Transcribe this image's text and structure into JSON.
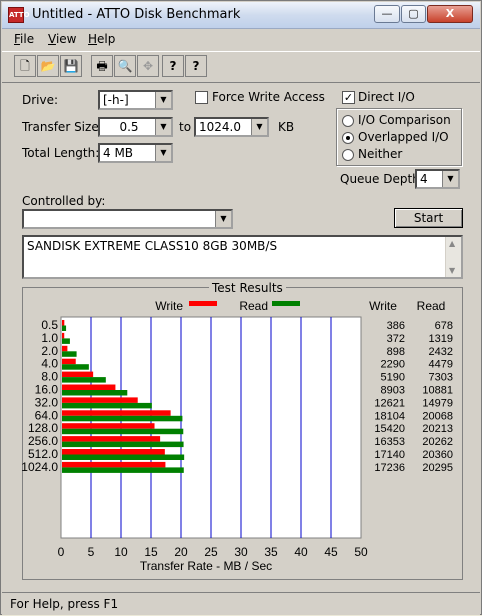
{
  "window": {
    "title": "Untitled - ATTO Disk Benchmark",
    "app_icon_text": "ATTO",
    "minimize_label": "—",
    "maximize_label": "▢",
    "close_label": "X"
  },
  "menu": {
    "items": [
      {
        "mnemonic": "F",
        "rest": "ile"
      },
      {
        "mnemonic": "V",
        "rest": "iew"
      },
      {
        "mnemonic": "H",
        "rest": "elp"
      }
    ]
  },
  "toolbar": {
    "icons": [
      "new-file-icon",
      "open-folder-icon",
      "save-icon",
      "print-icon",
      "print-preview-icon",
      "move-icon",
      "help-icon",
      "context-help-icon"
    ],
    "glyphs": [
      "🗋",
      "📂",
      "💾",
      "🖶",
      "🔍",
      "✥",
      "?",
      "?"
    ]
  },
  "settings": {
    "drive_label": "Drive:",
    "drive_value": "[-h-]",
    "force_write_label": "Force Write Access",
    "force_write_checked": false,
    "direct_io_label": "Direct I/O",
    "direct_io_checked": true,
    "transfer_size_label": "Transfer Size:",
    "transfer_from": "0.5",
    "to_label": "to",
    "transfer_to": "1024.0",
    "kb_label": "KB",
    "total_length_label": "Total Length:",
    "total_length_value": "4 MB",
    "io_options": [
      "I/O Comparison",
      "Overlapped I/O",
      "Neither"
    ],
    "io_selected": "Overlapped I/O",
    "queue_depth_label": "Queue Depth:",
    "queue_depth_value": "4",
    "controlled_by_label": "Controlled by:",
    "controlled_by_value": "",
    "start_label": "Start",
    "description": "SANDISK EXTREME CLASS10 8GB 30MB/S"
  },
  "results": {
    "title": "Test Results",
    "write_legend": "Write",
    "read_legend": "Read",
    "write_col": "Write",
    "read_col": "Read",
    "write_color": "#ff0000",
    "read_color": "#008000",
    "grid_color": "#0000cc"
  },
  "chart_data": {
    "type": "bar",
    "orientation": "horizontal",
    "title": "Test Results",
    "xlabel": "Transfer Rate - MB / Sec",
    "xlim": [
      0,
      50
    ],
    "xticks": [
      "0",
      "5",
      "10",
      "15",
      "20",
      "25",
      "30",
      "35",
      "40",
      "45",
      "50"
    ],
    "categories": [
      "0.5",
      "1.0",
      "2.0",
      "4.0",
      "8.0",
      "16.0",
      "32.0",
      "64.0",
      "128.0",
      "256.0",
      "512.0",
      "1024.0"
    ],
    "series": [
      {
        "name": "Write",
        "values": [
          386,
          372,
          898,
          2290,
          5190,
          8903,
          12621,
          18104,
          15420,
          16353,
          17140,
          17236
        ]
      },
      {
        "name": "Read",
        "values": [
          678,
          1319,
          2432,
          4479,
          7303,
          10881,
          14979,
          20068,
          20213,
          20262,
          20360,
          20295
        ]
      }
    ],
    "write_display": [
      "386",
      "372",
      "898",
      "2290",
      "5190",
      "8903",
      "12621",
      "18104",
      "15420",
      "16353",
      "17140",
      "17236"
    ],
    "read_display": [
      "678",
      "1319",
      "2432",
      "4479",
      "7303",
      "10881",
      "14979",
      "20068",
      "20213",
      "20262",
      "20360",
      "20295"
    ],
    "grid": true,
    "legend": "top"
  },
  "status": {
    "text": "For Help, press F1"
  }
}
